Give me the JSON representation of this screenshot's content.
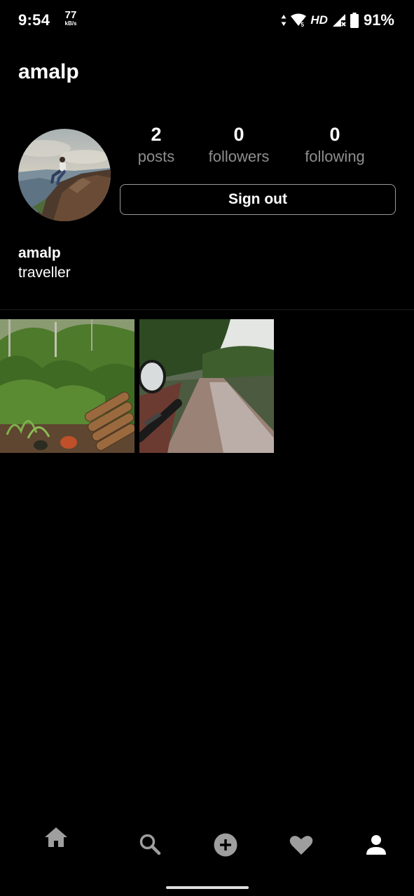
{
  "status_bar": {
    "time": "9:54",
    "net_speed_value": "77",
    "net_speed_unit": "kB/s",
    "network_label": "HD",
    "battery": "91%"
  },
  "header": {
    "title": "amalp"
  },
  "profile": {
    "stats": [
      {
        "count": "2",
        "label": "posts"
      },
      {
        "count": "0",
        "label": "followers"
      },
      {
        "count": "0",
        "label": "following"
      }
    ],
    "sign_out_label": "Sign out",
    "name": "amalp",
    "bio": "traveller"
  },
  "posts": [
    {
      "subject": "forest undergrowth with stacked logs and potted plants"
    },
    {
      "subject": "wet road viewed past a scooter mirror and handlebar"
    }
  ],
  "bottom_nav": {
    "items": [
      "home-icon",
      "search-icon",
      "add-post-icon",
      "heart-icon",
      "profile-icon"
    ],
    "active": "profile-icon"
  },
  "colors": {
    "background": "#000000",
    "text": "#ffffff",
    "secondary_text": "#8e8e8e",
    "inactive_icon": "#9e9e9e"
  }
}
